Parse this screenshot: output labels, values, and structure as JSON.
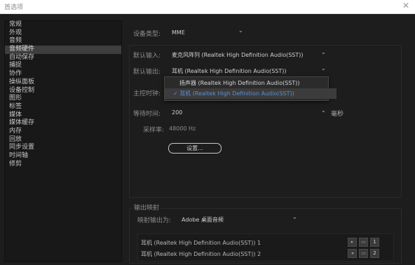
{
  "window": {
    "title": "首选项",
    "close_glyph": "✕"
  },
  "sidebar": {
    "items": [
      "常规",
      "外观",
      "音频",
      "音频硬件",
      "自动保存",
      "捕捉",
      "协作",
      "操纵面板",
      "设备控制",
      "图形",
      "标签",
      "媒体",
      "媒体缓存",
      "内存",
      "回放",
      "同步设置",
      "时间轴",
      "修剪"
    ],
    "selected_index": 3
  },
  "audio": {
    "device_type_label": "设备类型:",
    "device_type_value": "MME",
    "default_input_label": "默认输入:",
    "default_input_value": "麦克风阵列 (Realtek High Definition Audio(SST))",
    "default_output_label": "默认输出:",
    "default_output_value": "耳机 (Realtek High Definition Audio(SST))",
    "master_clock_label": "主控时钟:",
    "menu_options": [
      "扬声器 (Realtek High Definition Audio(SST))",
      "耳机 (Realtek High Definition Audio(SST))"
    ],
    "menu_selected_index": 1,
    "checkmark": "✓",
    "latency_label": "等待时间:",
    "latency_value": "200",
    "latency_unit": "毫秒",
    "sample_rate_label": "采样率:",
    "sample_rate_value": "48000 Hz",
    "settings_button": "设置..."
  },
  "output_mapping": {
    "section_title": "输出映射",
    "map_output_label": "映射输出为:",
    "map_output_value": "Adobe 桌面音频",
    "channels": [
      {
        "name": "耳机 (Realtek High Definition Audio(SST)) 1",
        "number": "1"
      },
      {
        "name": "耳机 (Realtek High Definition Audio(SST)) 2",
        "number": "2"
      }
    ]
  },
  "chevron_glyph": "⌄",
  "colors": {
    "background": "#1d1d1d",
    "selected_item": "#3e3e3e",
    "menu_highlight_text": "#5a8fd8"
  }
}
